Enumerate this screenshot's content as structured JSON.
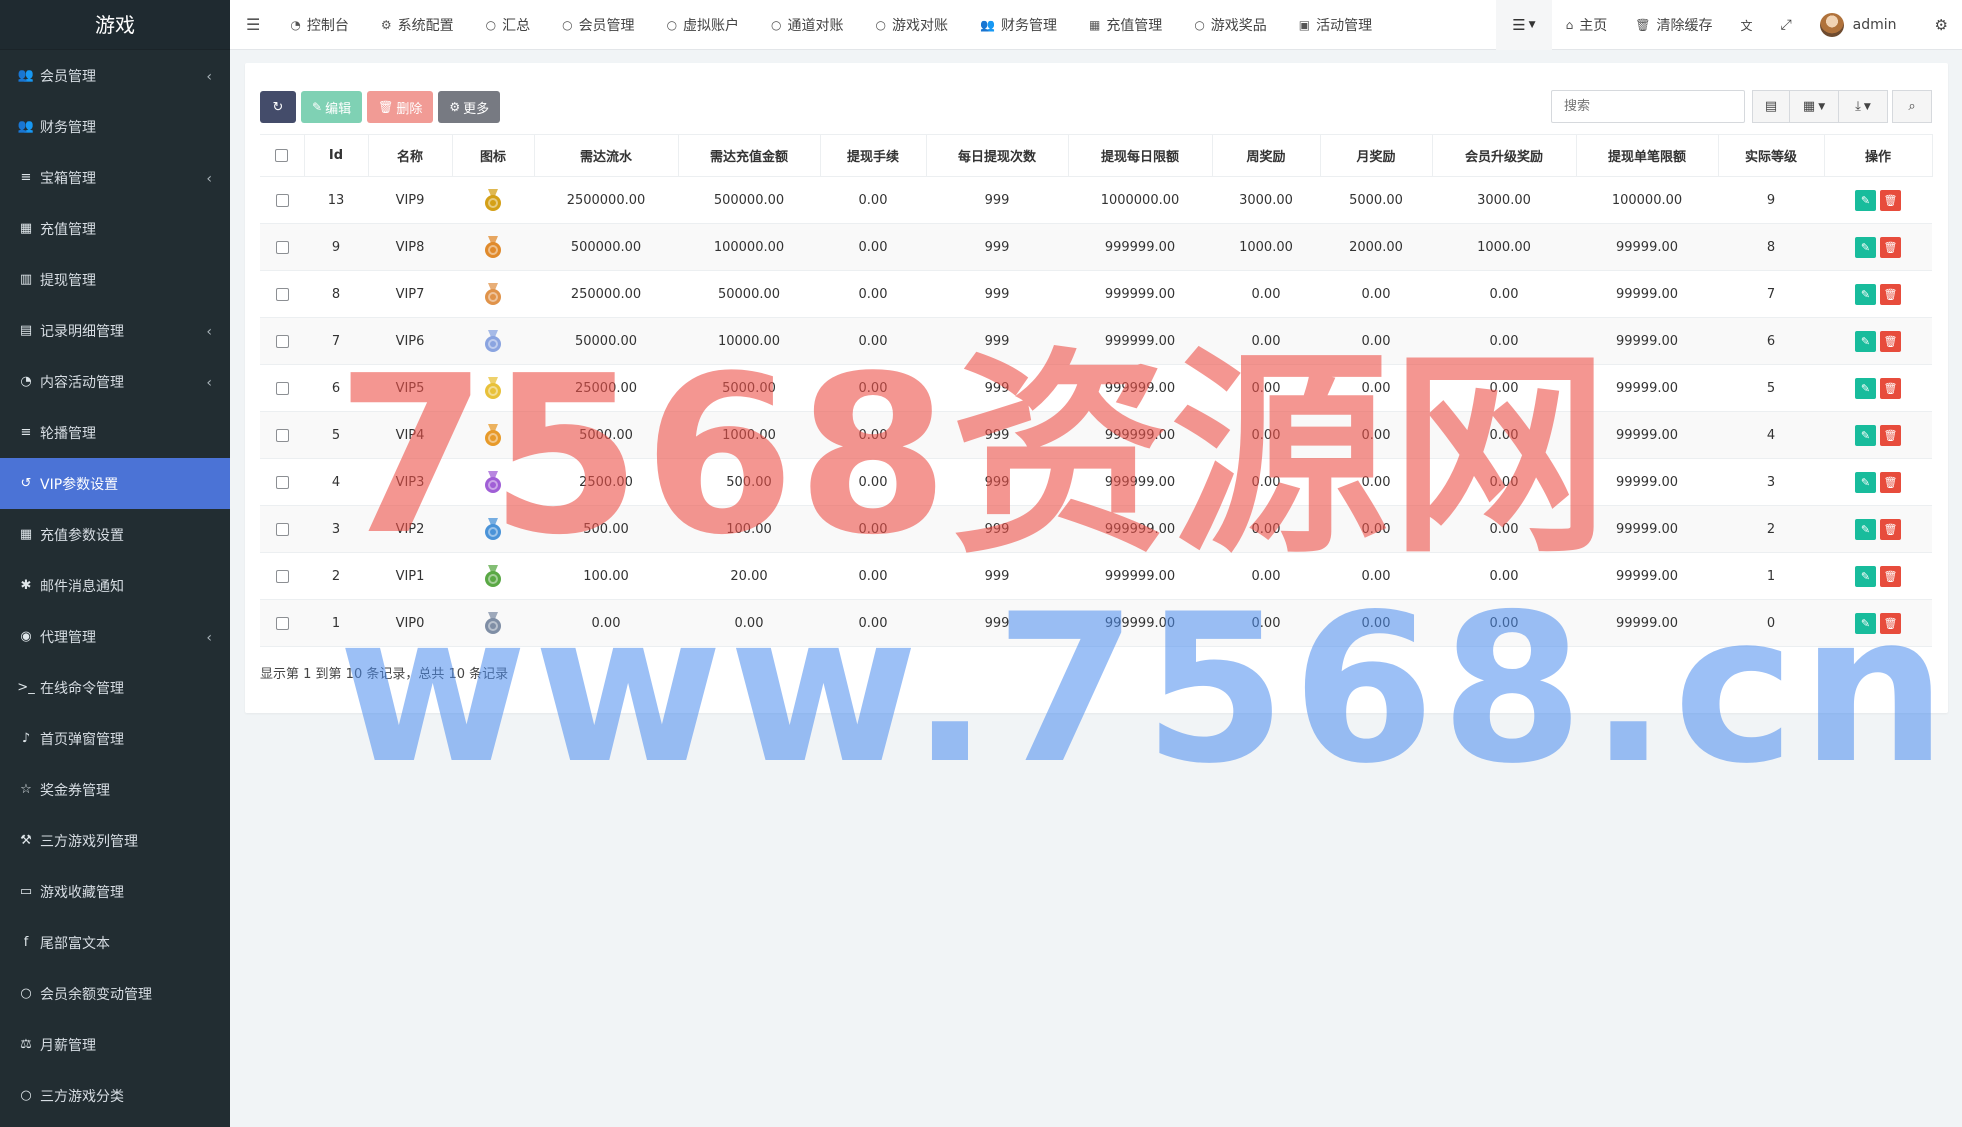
{
  "app": {
    "title": "游戏"
  },
  "sidebar": {
    "items": [
      {
        "icon": "users-icon",
        "label": "会员管理",
        "caret": true
      },
      {
        "icon": "users-icon",
        "label": "财务管理",
        "caret": false
      },
      {
        "icon": "list-icon",
        "label": "宝箱管理",
        "caret": true
      },
      {
        "icon": "th-large-icon",
        "label": "充值管理",
        "caret": false
      },
      {
        "icon": "bar-chart-icon",
        "label": "提现管理",
        "caret": false
      },
      {
        "icon": "line-chart-icon",
        "label": "记录明细管理",
        "caret": true
      },
      {
        "icon": "dashboard-icon",
        "label": "内容活动管理",
        "caret": true
      },
      {
        "icon": "list-icon",
        "label": "轮播管理",
        "caret": false
      },
      {
        "icon": "history-icon",
        "label": "VIP参数设置",
        "caret": false,
        "active": true
      },
      {
        "icon": "th-icon",
        "label": "充值参数设置",
        "caret": false
      },
      {
        "icon": "asterisk-icon",
        "label": "邮件消息通知",
        "caret": false
      },
      {
        "icon": "user-circle-icon",
        "label": "代理管理",
        "caret": true
      },
      {
        "icon": "terminal-icon",
        "label": "在线命令管理",
        "caret": false
      },
      {
        "icon": "bell-icon",
        "label": "首页弹窗管理",
        "caret": false
      },
      {
        "icon": "star-icon",
        "label": "奖金券管理",
        "caret": false
      },
      {
        "icon": "gavel-icon",
        "label": "三方游戏列管理",
        "caret": false
      },
      {
        "icon": "folder-open-icon",
        "label": "游戏收藏管理",
        "caret": false
      },
      {
        "icon": "facebook-icon",
        "label": "尾部富文本",
        "caret": false
      },
      {
        "icon": "circle-icon",
        "label": "会员余额变动管理",
        "caret": false
      },
      {
        "icon": "balance-scale-icon",
        "label": "月薪管理",
        "caret": false
      },
      {
        "icon": "circle-icon",
        "label": "三方游戏分类",
        "caret": false
      }
    ]
  },
  "navbar": {
    "tabs": [
      {
        "icon": "dashboard-icon",
        "label": "控制台"
      },
      {
        "icon": "cog-icon",
        "label": "系统配置"
      },
      {
        "icon": "circle-icon",
        "label": "汇总"
      },
      {
        "icon": "circle-icon",
        "label": "会员管理"
      },
      {
        "icon": "circle-icon",
        "label": "虚拟账户"
      },
      {
        "icon": "circle-icon",
        "label": "通道对账"
      },
      {
        "icon": "circle-icon",
        "label": "游戏对账"
      },
      {
        "icon": "users-icon",
        "label": "财务管理"
      },
      {
        "icon": "th-large-icon",
        "label": "充值管理"
      },
      {
        "icon": "circle-icon",
        "label": "游戏奖品"
      },
      {
        "icon": "calendar-icon",
        "label": "活动管理"
      }
    ],
    "home": "主页",
    "clear_cache": "清除缓存",
    "user": "admin"
  },
  "toolbar": {
    "edit": "编辑",
    "delete": "删除",
    "more": "更多",
    "search_placeholder": "搜索"
  },
  "table": {
    "columns": [
      "Id",
      "名称",
      "图标",
      "需达流水",
      "需达充值金额",
      "提现手续",
      "每日提现次数",
      "提现每日限额",
      "周奖励",
      "月奖励",
      "会员升级奖励",
      "提现单笔限额",
      "实际等级",
      "操作"
    ],
    "rows": [
      {
        "id": "13",
        "name": "VIP9",
        "badge": "#d4a017",
        "turnover": "2500000.00",
        "recharge": "500000.00",
        "fee": "0.00",
        "times": "999",
        "daily": "1000000.00",
        "week": "3000.00",
        "month": "5000.00",
        "upgrade": "3000.00",
        "single": "100000.00",
        "level": "9"
      },
      {
        "id": "9",
        "name": "VIP8",
        "badge": "#e08a2c",
        "turnover": "500000.00",
        "recharge": "100000.00",
        "fee": "0.00",
        "times": "999",
        "daily": "999999.00",
        "week": "1000.00",
        "month": "2000.00",
        "upgrade": "1000.00",
        "single": "99999.00",
        "level": "8"
      },
      {
        "id": "8",
        "name": "VIP7",
        "badge": "#e0934a",
        "turnover": "250000.00",
        "recharge": "50000.00",
        "fee": "0.00",
        "times": "999",
        "daily": "999999.00",
        "week": "0.00",
        "month": "0.00",
        "upgrade": "0.00",
        "single": "99999.00",
        "level": "7"
      },
      {
        "id": "7",
        "name": "VIP6",
        "badge": "#8aa4e0",
        "turnover": "50000.00",
        "recharge": "10000.00",
        "fee": "0.00",
        "times": "999",
        "daily": "999999.00",
        "week": "0.00",
        "month": "0.00",
        "upgrade": "0.00",
        "single": "99999.00",
        "level": "6"
      },
      {
        "id": "6",
        "name": "VIP5",
        "badge": "#e8c13a",
        "turnover": "25000.00",
        "recharge": "5000.00",
        "fee": "0.00",
        "times": "999",
        "daily": "999999.00",
        "week": "0.00",
        "month": "0.00",
        "upgrade": "0.00",
        "single": "99999.00",
        "level": "5"
      },
      {
        "id": "5",
        "name": "VIP4",
        "badge": "#e79a2a",
        "turnover": "5000.00",
        "recharge": "1000.00",
        "fee": "0.00",
        "times": "999",
        "daily": "999999.00",
        "week": "0.00",
        "month": "0.00",
        "upgrade": "0.00",
        "single": "99999.00",
        "level": "4"
      },
      {
        "id": "4",
        "name": "VIP3",
        "badge": "#a05fd6",
        "turnover": "2500.00",
        "recharge": "500.00",
        "fee": "0.00",
        "times": "999",
        "daily": "999999.00",
        "week": "0.00",
        "month": "0.00",
        "upgrade": "0.00",
        "single": "99999.00",
        "level": "3"
      },
      {
        "id": "3",
        "name": "VIP2",
        "badge": "#4a93d8",
        "turnover": "500.00",
        "recharge": "100.00",
        "fee": "0.00",
        "times": "999",
        "daily": "999999.00",
        "week": "0.00",
        "month": "0.00",
        "upgrade": "0.00",
        "single": "99999.00",
        "level": "2"
      },
      {
        "id": "2",
        "name": "VIP1",
        "badge": "#5aa845",
        "turnover": "100.00",
        "recharge": "20.00",
        "fee": "0.00",
        "times": "999",
        "daily": "999999.00",
        "week": "0.00",
        "month": "0.00",
        "upgrade": "0.00",
        "single": "99999.00",
        "level": "1"
      },
      {
        "id": "1",
        "name": "VIP0",
        "badge": "#7f8ea5",
        "turnover": "0.00",
        "recharge": "0.00",
        "fee": "0.00",
        "times": "999",
        "daily": "999999.00",
        "week": "0.00",
        "month": "0.00",
        "upgrade": "0.00",
        "single": "99999.00",
        "level": "0"
      }
    ]
  },
  "pagination": {
    "summary": "显示第 1 到第 10 条记录，总共 10 条记录"
  },
  "watermark": {
    "line1": "7568资源网",
    "line2": "www.7568.cn"
  }
}
